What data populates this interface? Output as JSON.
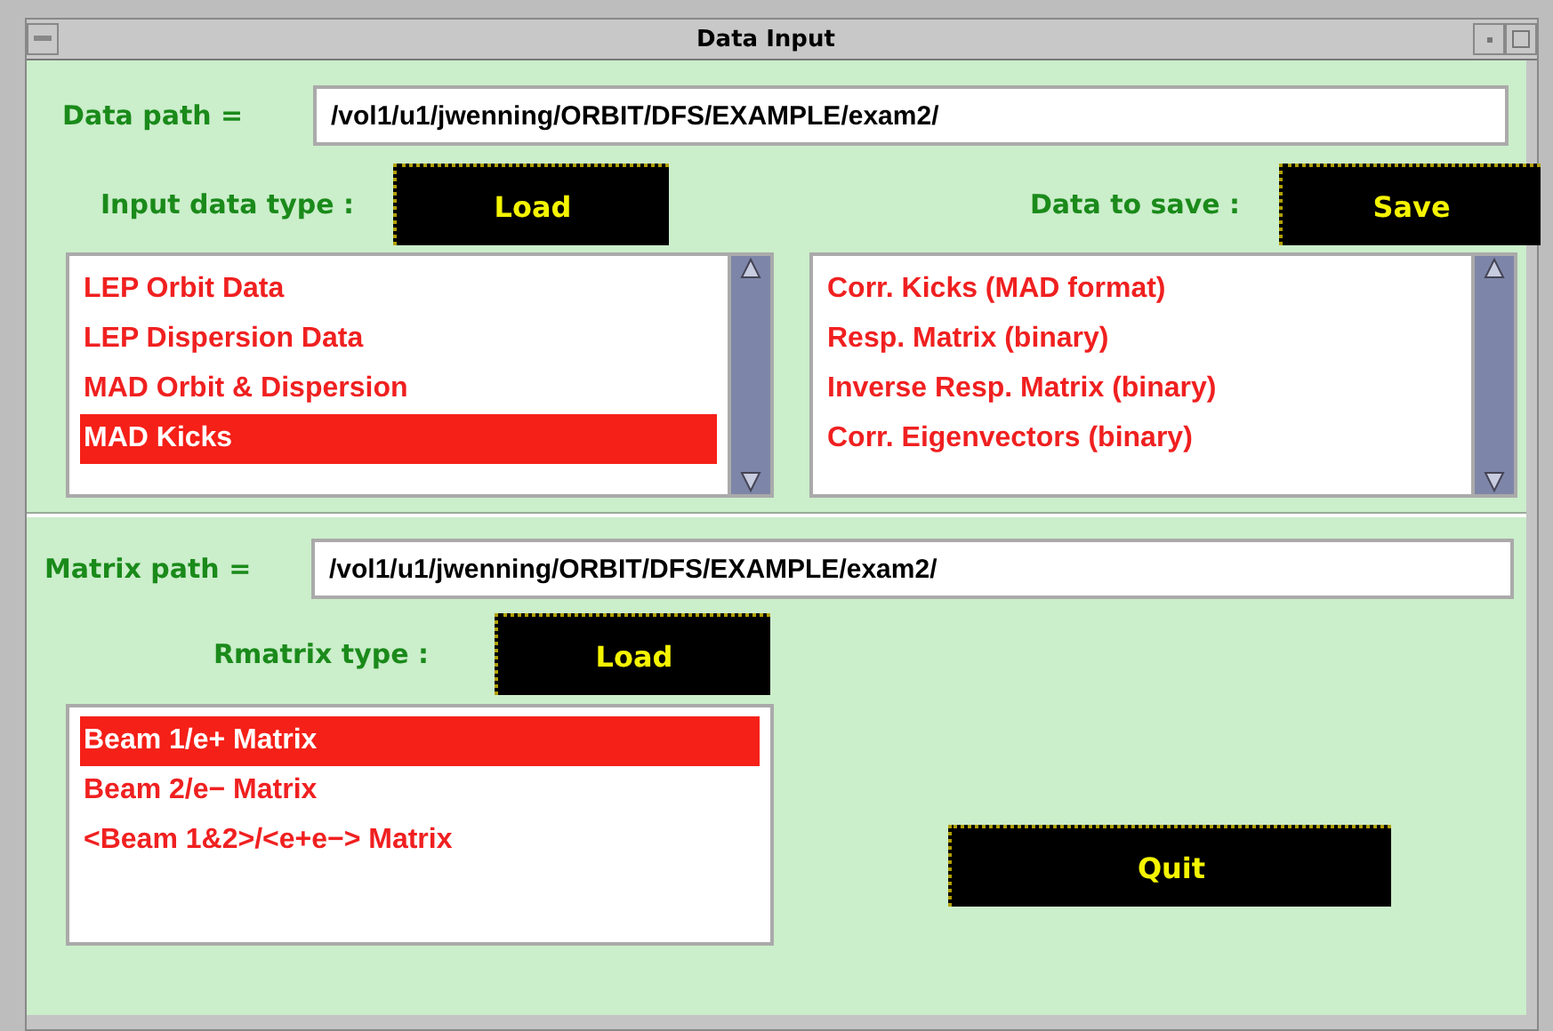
{
  "window": {
    "title": "Data Input"
  },
  "data_path": {
    "label": "Data path =",
    "value": "/vol1/u1/jwenning/ORBIT/DFS/EXAMPLE/exam2/"
  },
  "input_data_type": {
    "label": "Input data type :",
    "button": "Load",
    "items": [
      {
        "label": "LEP Orbit Data",
        "selected": false
      },
      {
        "label": "LEP Dispersion Data",
        "selected": false
      },
      {
        "label": "MAD Orbit & Dispersion",
        "selected": false
      },
      {
        "label": "MAD Kicks",
        "selected": true
      }
    ]
  },
  "data_to_save": {
    "label": "Data to save :",
    "button": "Save",
    "items": [
      {
        "label": "Corr. Kicks (MAD format)",
        "selected": false
      },
      {
        "label": "Resp. Matrix (binary)",
        "selected": false
      },
      {
        "label": "Inverse Resp. Matrix (binary)",
        "selected": false
      },
      {
        "label": "Corr. Eigenvectors (binary)",
        "selected": false
      }
    ]
  },
  "matrix_path": {
    "label": "Matrix path =",
    "value": "/vol1/u1/jwenning/ORBIT/DFS/EXAMPLE/exam2/"
  },
  "rmatrix_type": {
    "label": "Rmatrix type :",
    "button": "Load",
    "items": [
      {
        "label": "Beam 1/e+ Matrix",
        "selected": true
      },
      {
        "label": "Beam 2/e− Matrix",
        "selected": false
      },
      {
        "label": "<Beam 1&2>/<e+e−> Matrix",
        "selected": false
      }
    ]
  },
  "quit_button": "Quit"
}
